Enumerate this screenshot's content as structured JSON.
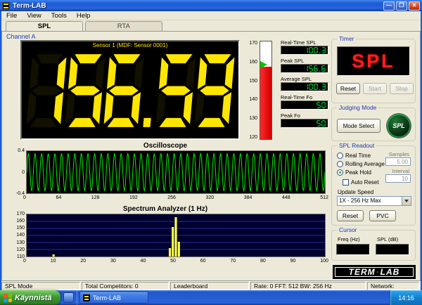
{
  "window": {
    "title": "Term-LAB",
    "menu": [
      "File",
      "View",
      "Tools",
      "Help"
    ],
    "controls": {
      "minimize": "—",
      "maximize": "❐",
      "close": "✕"
    }
  },
  "tabs": {
    "spl": "SPL",
    "rta": "RTA"
  },
  "channel": {
    "label": "Channel A",
    "sensor_label": "Sensor 1 (MDF: Sensor 0001)",
    "display_value": "156.59"
  },
  "meter": {
    "ticks": [
      "170",
      "160",
      "150",
      "140",
      "130",
      "120"
    ],
    "min": 120,
    "max": 170,
    "value": 157,
    "peak": 158
  },
  "readouts": [
    {
      "label": "Real-Time SPL",
      "value": "100.3"
    },
    {
      "label": "Peak SPL",
      "value": "156.6"
    },
    {
      "label": "Average SPL",
      "value": "100.3"
    },
    {
      "label": "Real-Time Fo",
      "value": "50"
    },
    {
      "label": "Peak Fo",
      "value": "50"
    }
  ],
  "timer": {
    "title": "Timer",
    "display": "SPL",
    "reset": "Reset",
    "start": "Start",
    "stop": "Stop"
  },
  "judging": {
    "title": "Judging Mode",
    "mode_select": "Mode Select",
    "badge": "SPL"
  },
  "spl_readout": {
    "title": "SPL Readout",
    "radio_real_time": "Real Time",
    "radio_rolling": "Rolling Average",
    "radio_peak_hold": "Peak Hold",
    "selected": "Peak Hold",
    "auto_reset": "Auto Reset",
    "samples_label": "Samples",
    "samples_value": "5.00",
    "interval_label": "Interval",
    "interval_value": "10",
    "update_speed_label": "Update Speed",
    "update_speed_value": "1X - 256 Hz Max",
    "reset": "Reset",
    "pvc": "PVC"
  },
  "cursor": {
    "title": "Cursor",
    "freq_label": "Freq (Hz)",
    "spl_label": "SPL (dB)",
    "freq_value": "",
    "spl_value": ""
  },
  "logo": {
    "term": "TERM",
    "dot": "·",
    "lab": "LAB"
  },
  "oscilloscope": {
    "title": "Oscilloscope",
    "y_ticks": [
      "0.4",
      "0",
      "-0.4"
    ],
    "x_ticks": [
      "0",
      "64",
      "128",
      "192",
      "256",
      "320",
      "384",
      "448",
      "512"
    ],
    "cycles": 45,
    "amplitude": 0.4
  },
  "spectrum": {
    "title": "Spectrum Analyzer (1 Hz)",
    "y_ticks": [
      "170",
      "160",
      "150",
      "140",
      "130",
      "120",
      "110"
    ],
    "x_ticks": [
      "0",
      "10",
      "20",
      "30",
      "40",
      "50",
      "60",
      "70",
      "80",
      "90",
      "100"
    ],
    "y_min": 110,
    "y_max": 170,
    "bars": [
      {
        "f": 9,
        "v": 113
      },
      {
        "f": 48,
        "v": 122
      },
      {
        "f": 49,
        "v": 152
      },
      {
        "f": 50,
        "v": 166
      },
      {
        "f": 51,
        "v": 131
      }
    ]
  },
  "status": {
    "items": [
      "SPL Mode",
      "Total Competitors: 0",
      "Leaderboard",
      "Rate: 0 FFT: 512 BW: 256 Hz",
      "Network:"
    ]
  },
  "taskbar": {
    "start": "Käynnistä",
    "task": "Term-LAB",
    "time": "14:16"
  },
  "colors": {
    "seg_yellow": "#ffe600",
    "lcd_green": "#00e03c",
    "timer_red": "#ff1e1e",
    "wave_green": "#00ee00",
    "bar_yellow": "#ffff44",
    "grid_blue": "#24308c"
  }
}
